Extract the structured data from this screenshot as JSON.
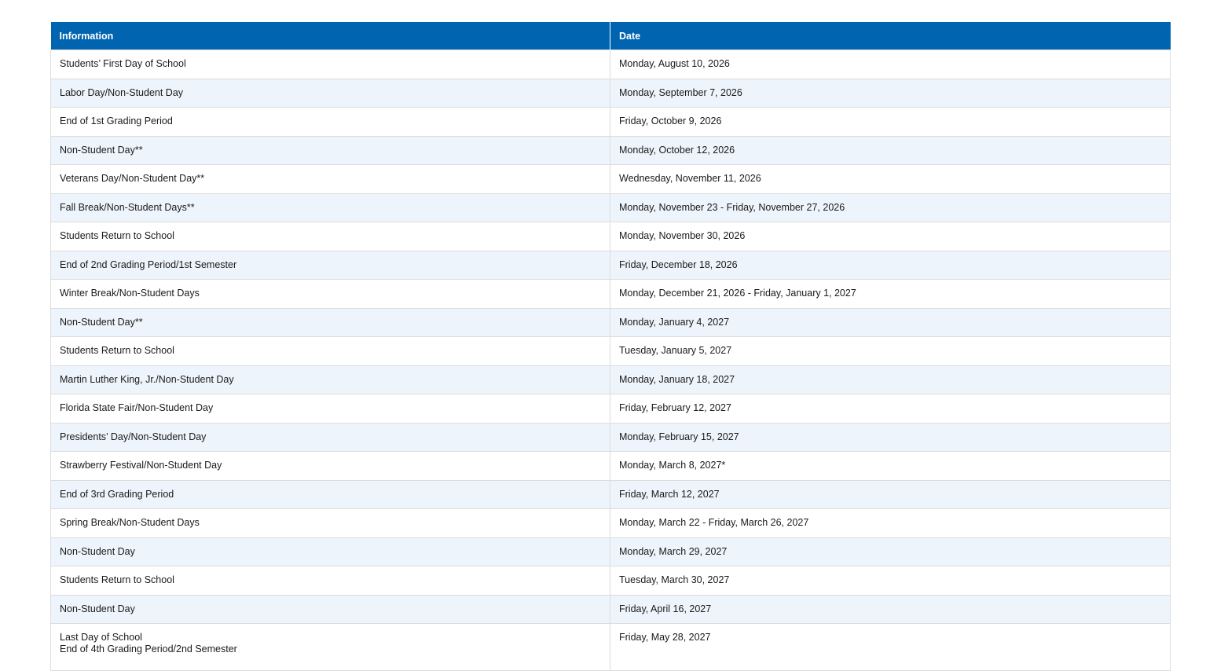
{
  "table": {
    "headers": [
      "Information",
      "Date"
    ],
    "rows": [
      {
        "info": "Students’ First Day of School",
        "date": "Monday, August 10, 2026"
      },
      {
        "info": "Labor Day/Non-Student Day",
        "date": "Monday, September 7, 2026"
      },
      {
        "info": "End of 1st Grading Period",
        "date": "Friday, October 9, 2026"
      },
      {
        "info": "Non-Student Day**",
        "date": "Monday, October 12, 2026"
      },
      {
        "info": "Veterans Day/Non-Student Day**",
        "date": "Wednesday, November 11, 2026"
      },
      {
        "info": "Fall Break/Non-Student Days**",
        "date": "Monday, November 23 - Friday, November 27, 2026"
      },
      {
        "info": "Students Return to School",
        "date": "Monday, November 30, 2026"
      },
      {
        "info": "End of 2nd Grading Period/1st Semester",
        "date": "Friday, December 18, 2026"
      },
      {
        "info": "Winter Break/Non-Student Days",
        "date": "Monday, December 21, 2026 - Friday, January 1, 2027"
      },
      {
        "info": "Non-Student Day**",
        "date": "Monday, January 4, 2027"
      },
      {
        "info": "Students Return to School",
        "date": "Tuesday, January 5, 2027"
      },
      {
        "info": "Martin Luther King, Jr./Non-Student Day",
        "date": "Monday, January 18, 2027"
      },
      {
        "info": "Florida State Fair/Non-Student Day",
        "date": "Friday, February 12, 2027"
      },
      {
        "info": "Presidents’ Day/Non-Student Day",
        "date": "Monday, February 15, 2027"
      },
      {
        "info": "Strawberry Festival/Non-Student Day",
        "date": "Monday, March 8, 2027*"
      },
      {
        "info": "End of 3rd Grading Period",
        "date": "Friday, March 12, 2027"
      },
      {
        "info": "Spring Break/Non-Student Days",
        "date": "Monday, March 22 - Friday, March 26, 2027"
      },
      {
        "info": "Non-Student Day",
        "date": "Monday, March 29, 2027"
      },
      {
        "info": "Students Return to School",
        "date": "Tuesday, March 30, 2027"
      },
      {
        "info": "Non-Student Day",
        "date": "Friday, April 16, 2027"
      }
    ],
    "last_row": {
      "info_line1": "Last Day of School",
      "info_line2": "End of 4th Grading Period/2nd Semester",
      "date": "Friday, May 28, 2027"
    }
  },
  "colors": {
    "header_bg": "#0064b0",
    "stripe_bg": "#eef4fb"
  }
}
